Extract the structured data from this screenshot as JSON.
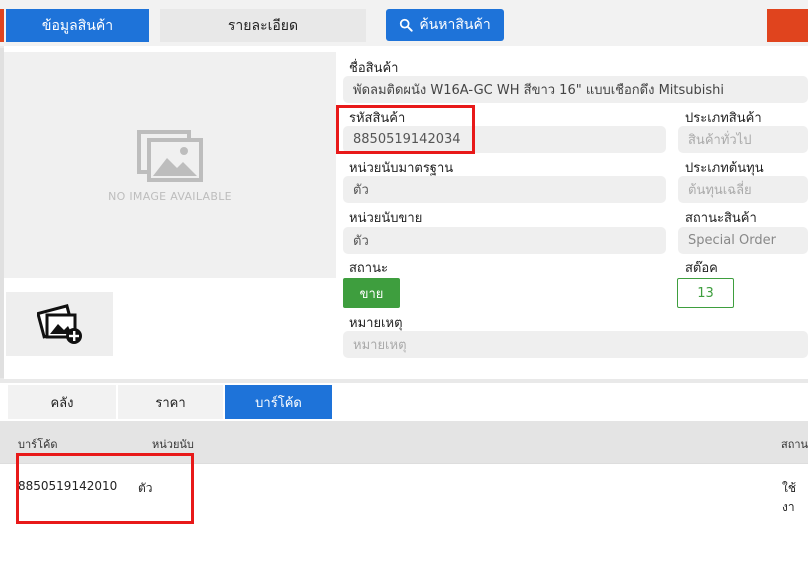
{
  "header": {
    "tab_product_info": "ข้อมูลสินค้า",
    "tab_details": "รายละเอียด",
    "search_button": "ค้นหาสินค้า"
  },
  "image": {
    "placeholder_text": "NO IMAGE AVAILABLE"
  },
  "product": {
    "name_label": "ชื่อสินค้า",
    "name_value": "พัดลมติดผนัง W16A-GC WH สีขาว 16\" แบบเชือกดึง Mitsubishi",
    "code_label": "รหัสสินค้า",
    "code_value": "8850519142034",
    "type_label": "ประเภทสินค้า",
    "type_placeholder": "สินค้าทั่วไป",
    "unit_std_label": "หน่วยนับมาตรฐาน",
    "unit_std_value": "ตัว",
    "cost_type_label": "ประเภทต้นทุน",
    "cost_type_placeholder": "ต้นทุนเฉลี่ย",
    "unit_sell_label": "หน่วยนับขาย",
    "unit_sell_value": "ตัว",
    "product_status_label": "สถานะสินค้า",
    "product_status_value": "Special Order",
    "status_label": "สถานะ",
    "status_button": "ขาย",
    "stock_label": "สต๊อค",
    "stock_value": "13",
    "note_label": "หมายเหตุ",
    "note_placeholder": "หมายเหตุ"
  },
  "lower_tabs": [
    {
      "label": "คลัง",
      "active": false
    },
    {
      "label": "ราคา",
      "active": false
    },
    {
      "label": "บาร์โค้ด",
      "active": true
    }
  ],
  "barcode_table": {
    "headers": {
      "barcode": "บาร์โค้ด",
      "unit": "หน่วยนับ",
      "status": "สถาน"
    },
    "rows": [
      {
        "barcode": "8850519142010",
        "unit": "ตัว",
        "status": "ใช้งา"
      }
    ]
  },
  "colors": {
    "primary": "#1e73d9",
    "accent_orange": "#e0441e",
    "success": "#3e9e3e",
    "highlight": "#e81919"
  }
}
